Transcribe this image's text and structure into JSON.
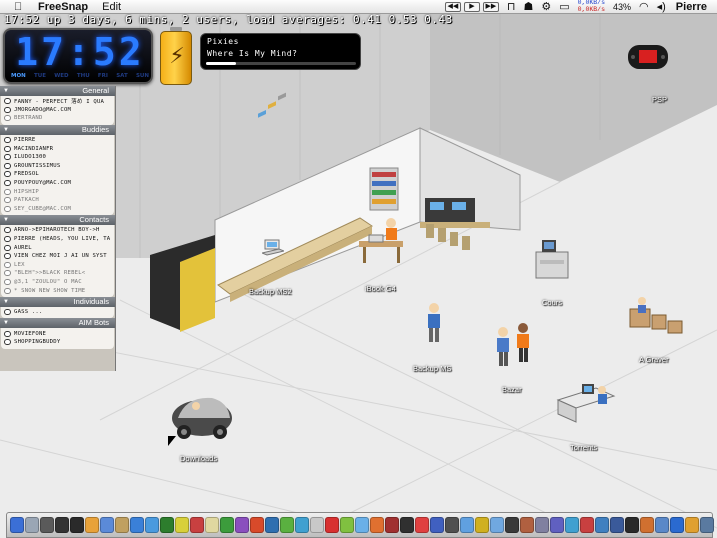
{
  "menubar": {
    "apple": "",
    "app_name": "FreeSnap",
    "menus": [
      "Edit"
    ],
    "net_up": "0,0KB/s",
    "net_down": "0,0KB/s",
    "battery_pct": "43%",
    "user": "Pierre"
  },
  "uptime": "17:52  up 3 days, 6 mins, 2 users, load averages: 0.41 0.53 0.43",
  "clock": {
    "time": "17:52",
    "days": [
      "MON",
      "TUE",
      "WED",
      "THU",
      "FRI",
      "SAT",
      "SUN"
    ],
    "active_day": "MON"
  },
  "now_playing": {
    "artist": "Pixies",
    "track": "Where Is My Mind?",
    "progress": 0.2
  },
  "buddy_list": {
    "groups": [
      {
        "name": "General",
        "buddies": [
          {
            "name": "FANNY - PERFECT 落め I QUA",
            "idle": false
          },
          {
            "name": "JMORGADO@MAC.COM",
            "idle": false
          },
          {
            "name": "BERTRAND",
            "idle": true
          }
        ]
      },
      {
        "name": "Buddies",
        "buddies": [
          {
            "name": "PIERRE",
            "idle": false
          },
          {
            "name": "MACINDIANFR",
            "idle": false
          },
          {
            "name": "ILUDO1300",
            "idle": false
          },
          {
            "name": "GROUNTISSIMUS",
            "idle": false
          },
          {
            "name": "FREDSOL",
            "idle": false
          },
          {
            "name": "POUYPOUY@MAC.COM",
            "idle": false
          },
          {
            "name": "HIPSHIP",
            "idle": true
          },
          {
            "name": "PATKACH",
            "idle": true
          },
          {
            "name": "SEY_CUBE@MAC.COM",
            "idle": true
          }
        ]
      },
      {
        "name": "Contacts",
        "buddies": [
          {
            "name": "ARNO->EPIHAROTECH BOY->H",
            "idle": false
          },
          {
            "name": "PIERRE (HEADS, YOU LIVE, TA",
            "idle": false
          },
          {
            "name": "AUREL",
            "idle": false
          },
          {
            "name": "VIEN CHEZ MOI J AI UN SYST",
            "idle": false
          },
          {
            "name": "LEX",
            "idle": true
          },
          {
            "name": "\"BLEH\">>BLACK REBEL<",
            "idle": true
          },
          {
            "name": "@3,1 \"ZOULOU\" O MAC",
            "idle": true
          },
          {
            "name": "*  SNOW NEW SHOW TIME",
            "idle": true
          }
        ]
      },
      {
        "name": "Individuals",
        "buddies": [
          {
            "name": "GASS ...",
            "idle": false
          }
        ]
      },
      {
        "name": "AIM Bots",
        "buddies": [
          {
            "name": "MOVIEFONE",
            "idle": false
          },
          {
            "name": "SHOPPINGBUDDY",
            "idle": false
          }
        ]
      }
    ]
  },
  "desktop_icons": {
    "psp": "PSP",
    "backup_ms2": "Backup MS2",
    "ibook_g4": "iBook G4",
    "cours": "Cours",
    "a_graver": "A Graver",
    "backup_ms": "Backup MS",
    "bazar": "Bazar",
    "torrents": "Torrents",
    "downloads": "Downloads"
  },
  "dock": {
    "colors": [
      "#3b6fd6",
      "#9aa6b5",
      "#5a5a5a",
      "#333333",
      "#2a2a2a",
      "#e8a23a",
      "#5b8ad8",
      "#c0a060",
      "#3a80d8",
      "#4a9ade",
      "#2d7d2d",
      "#d8d03a",
      "#c84040",
      "#e0d8a0",
      "#3c9c3c",
      "#8a4fbe",
      "#d84a2a",
      "#2f6fb0",
      "#5ab040",
      "#40a0d0",
      "#c8c8c8",
      "#d83030",
      "#80c040",
      "#6ab0e8",
      "#e07030",
      "#a03030",
      "#303030",
      "#e04040",
      "#4060c0",
      "#505050",
      "#60a0e0",
      "#d0b020",
      "#70a8e0",
      "#3a3a3a",
      "#b06040",
      "#8080a0",
      "#6060c0",
      "#40a0d0",
      "#c84040",
      "#4080c0",
      "#3a5a9a",
      "#2a2a2a",
      "#d07030",
      "#5a88c8",
      "#2a6ad0",
      "#e0a030",
      "#5a7aa0",
      "#707070",
      "#c8c8c8"
    ]
  }
}
